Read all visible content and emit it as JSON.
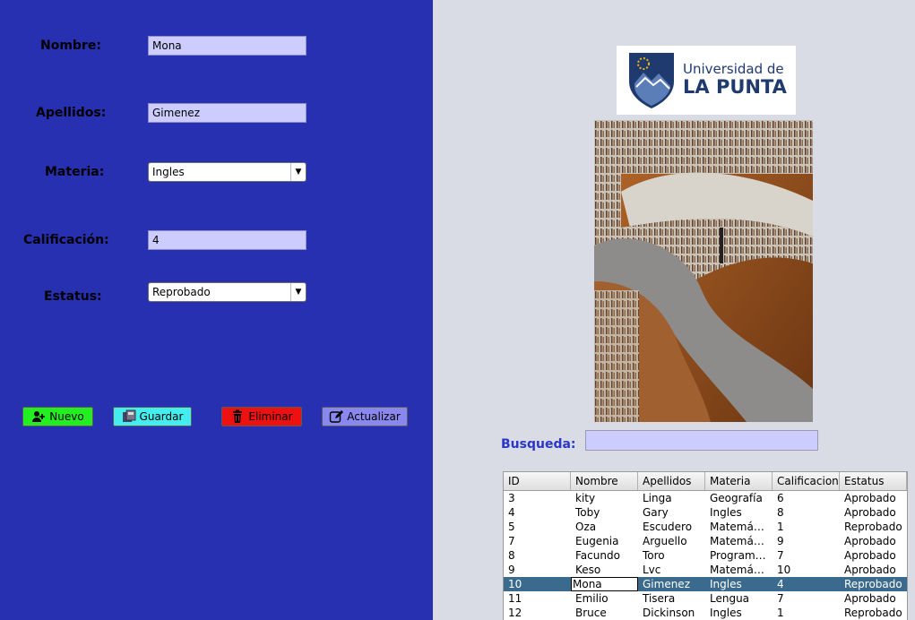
{
  "form": {
    "nombre_label": "Nombre:",
    "nombre_value": "Mona",
    "apellidos_label": "Apellidos:",
    "apellidos_value": "Gimenez",
    "materia_label": "Materia:",
    "materia_value": "Ingles",
    "calificacion_label": "Calificación:",
    "calificacion_value": "4",
    "estatus_label": "Estatus:",
    "estatus_value": "Reprobado"
  },
  "buttons": {
    "nuevo": "Nuevo",
    "guardar": "Guardar",
    "eliminar": "Eliminar",
    "actualizar": "Actualizar"
  },
  "colors": {
    "left_panel": "#2630b0",
    "field_bg": "#ccccff",
    "nuevo_bg": "#22ee22",
    "guardar_bg": "#44eeee",
    "eliminar_bg": "#ee1111",
    "actualizar_bg": "#8888ee",
    "selected_row": "#3a6a8e"
  },
  "logo": {
    "line1": "Universidad de",
    "line2": "LA PUNTA"
  },
  "search": {
    "label": "Busqueda:",
    "value": ""
  },
  "table": {
    "headers": [
      "ID",
      "Nombre",
      "Apellidos",
      "Materia",
      "Calificacion",
      "Estatus"
    ],
    "rows": [
      [
        "3",
        "kity",
        "Linga",
        "Geografía",
        "6",
        "Aprobado"
      ],
      [
        "4",
        "Toby",
        "Gary",
        "Ingles",
        "8",
        "Aprobado"
      ],
      [
        "5",
        "Oza",
        "Escudero",
        "Matemátic...",
        "1",
        "Reprobado"
      ],
      [
        "7",
        "Eugenia",
        "Arguello",
        "Matemátic...",
        "9",
        "Aprobado"
      ],
      [
        "8",
        "Facundo",
        "Toro",
        "Programa...",
        "7",
        "Aprobado"
      ],
      [
        "9",
        "Keso",
        "Lvc",
        "Matemátic...",
        "10",
        "Aprobado"
      ],
      [
        "10",
        "Mona",
        "Gimenez",
        "Ingles",
        "4",
        "Reprobado"
      ],
      [
        "11",
        "Emilio",
        "Tisera",
        "Lengua",
        "7",
        "Aprobado"
      ],
      [
        "12",
        "Bruce",
        "Dickinson",
        "Ingles",
        "1",
        "Reprobado"
      ]
    ],
    "selected_index": 6
  }
}
